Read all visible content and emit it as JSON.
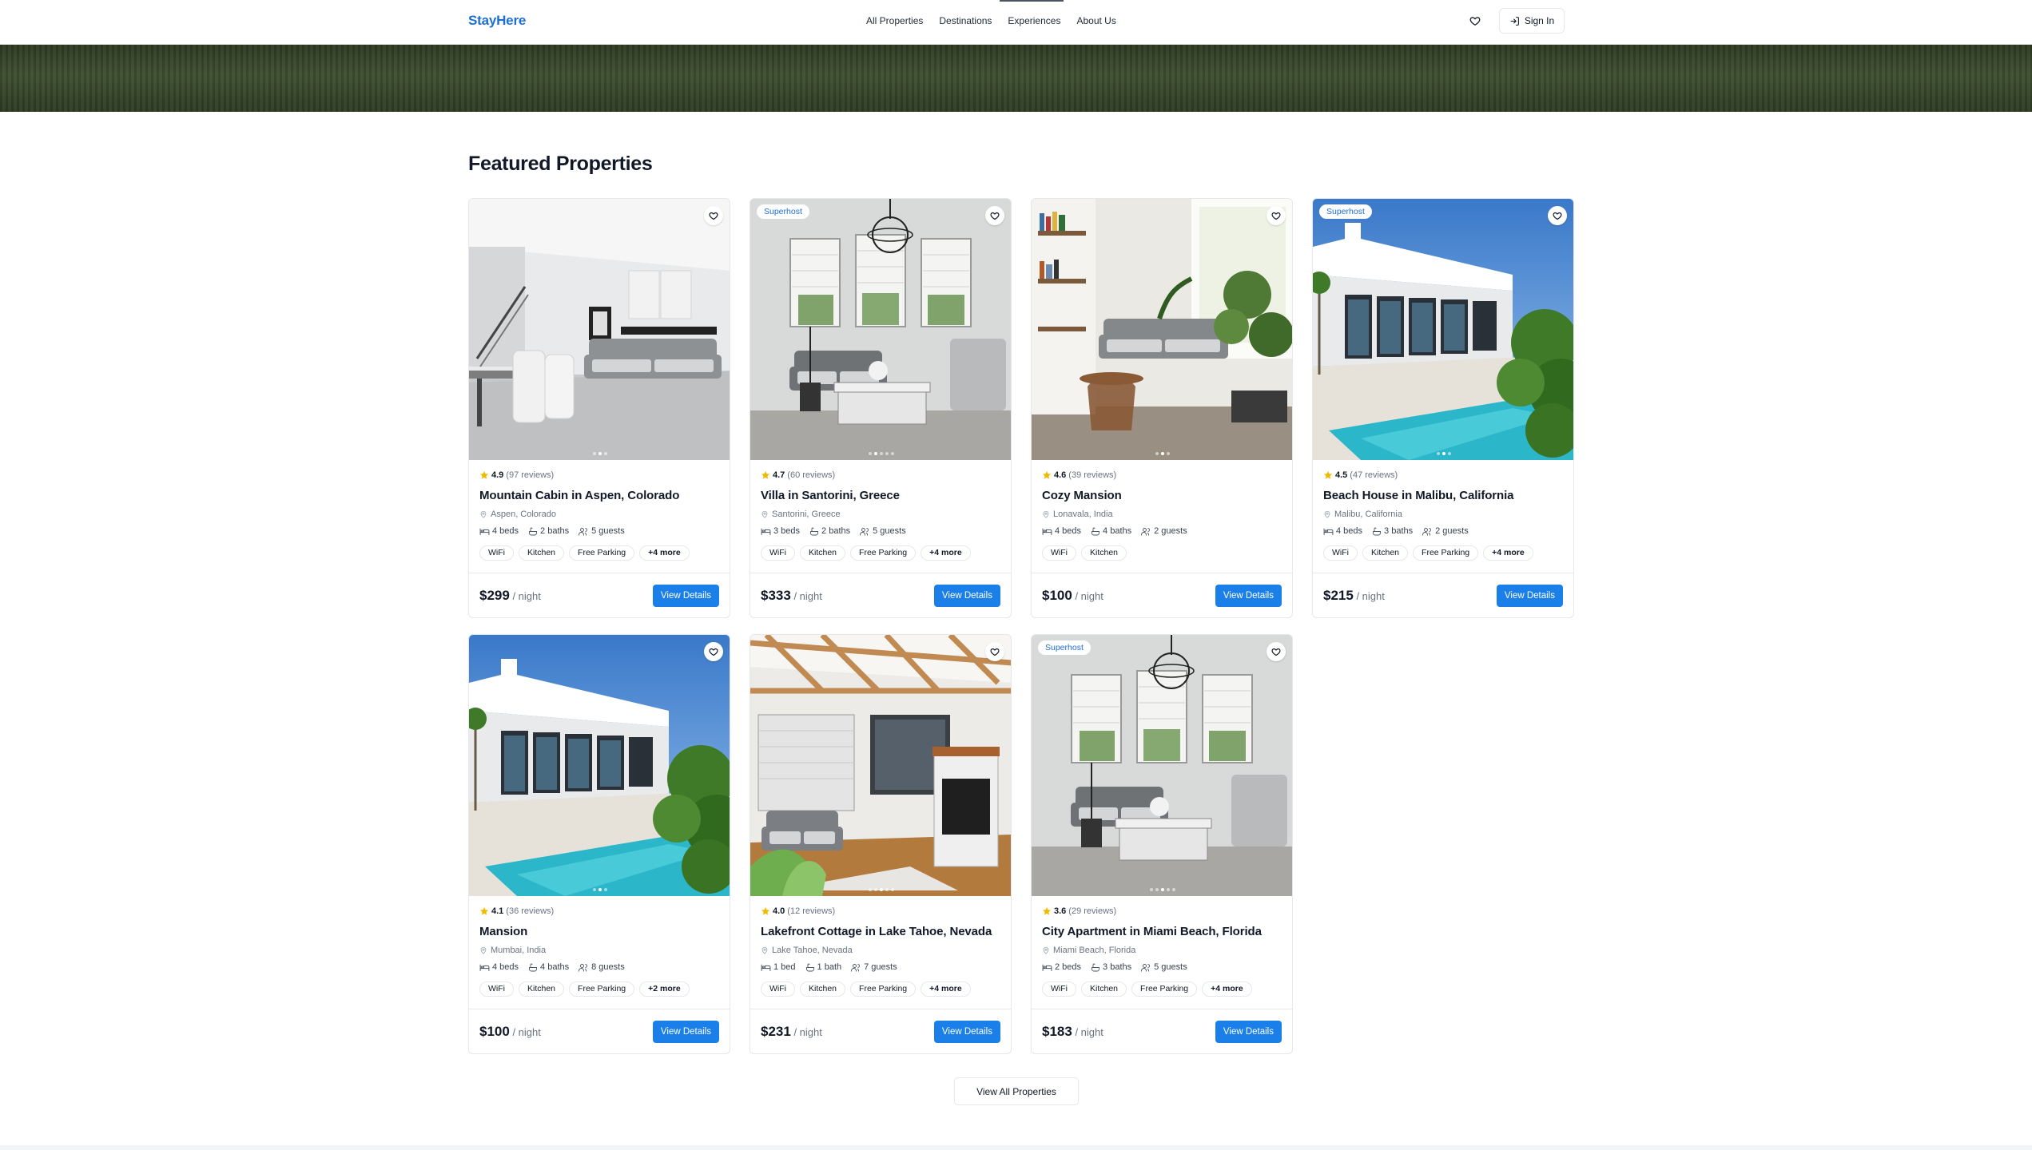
{
  "header": {
    "logo": "StayHere",
    "nav": [
      "All Properties",
      "Destinations",
      "Experiences",
      "About Us"
    ],
    "signin_label": "Sign In"
  },
  "section_title": "Featured Properties",
  "properties": [
    {
      "rating": "4.9",
      "reviews": "(97 reviews)",
      "title": "Mountain Cabin in Aspen, Colorado",
      "location": "Aspen, Colorado",
      "beds": "4 beds",
      "baths": "2 baths",
      "guests": "5 guests",
      "amenities": [
        "WiFi",
        "Kitchen",
        "Free Parking"
      ],
      "more": "+4 more",
      "price": "$299",
      "per": " / night",
      "cta": "View Details",
      "badge": ""
    },
    {
      "rating": "4.7",
      "reviews": "(60 reviews)",
      "title": "Villa in Santorini, Greece",
      "location": "Santorini, Greece",
      "beds": "3 beds",
      "baths": "2 baths",
      "guests": "5 guests",
      "amenities": [
        "WiFi",
        "Kitchen",
        "Free Parking"
      ],
      "more": "+4 more",
      "price": "$333",
      "per": " / night",
      "cta": "View Details",
      "badge": "Superhost"
    },
    {
      "rating": "4.6",
      "reviews": "(39 reviews)",
      "title": "Cozy Mansion",
      "location": "Lonavala, India",
      "beds": "4 beds",
      "baths": "4 baths",
      "guests": "2 guests",
      "amenities": [
        "WiFi",
        "Kitchen"
      ],
      "more": "",
      "price": "$100",
      "per": " / night",
      "cta": "View Details",
      "badge": ""
    },
    {
      "rating": "4.5",
      "reviews": "(47 reviews)",
      "title": "Beach House in Malibu, California",
      "location": "Malibu, California",
      "beds": "4 beds",
      "baths": "3 baths",
      "guests": "2 guests",
      "amenities": [
        "WiFi",
        "Kitchen",
        "Free Parking"
      ],
      "more": "+4 more",
      "price": "$215",
      "per": " / night",
      "cta": "View Details",
      "badge": "Superhost"
    },
    {
      "rating": "4.1",
      "reviews": "(36 reviews)",
      "title": "Mansion",
      "location": "Mumbai, India",
      "beds": "4 beds",
      "baths": "4 baths",
      "guests": "8 guests",
      "amenities": [
        "WiFi",
        "Kitchen",
        "Free Parking"
      ],
      "more": "+2 more",
      "price": "$100",
      "per": " / night",
      "cta": "View Details",
      "badge": ""
    },
    {
      "rating": "4.0",
      "reviews": "(12 reviews)",
      "title": "Lakefront Cottage in Lake Tahoe, Nevada",
      "location": "Lake Tahoe, Nevada",
      "beds": "1 bed",
      "baths": "1 bath",
      "guests": "7 guests",
      "amenities": [
        "WiFi",
        "Kitchen",
        "Free Parking"
      ],
      "more": "+4 more",
      "price": "$231",
      "per": " / night",
      "cta": "View Details",
      "badge": ""
    },
    {
      "rating": "3.6",
      "reviews": "(29 reviews)",
      "title": "City Apartment in Miami Beach, Florida",
      "location": "Miami Beach, Florida",
      "beds": "2 beds",
      "baths": "3 baths",
      "guests": "5 guests",
      "amenities": [
        "WiFi",
        "Kitchen",
        "Free Parking"
      ],
      "more": "+4 more",
      "price": "$183",
      "per": " / night",
      "cta": "View Details",
      "badge": "Superhost"
    }
  ],
  "view_all_label": "View All Properties",
  "colors": {
    "brand": "#1d6fd6",
    "button": "#1a7fe8",
    "star": "#f5b800"
  },
  "icons": [
    "heart-icon",
    "sign-in-icon",
    "star-icon",
    "map-pin-icon",
    "bed-icon",
    "bath-icon",
    "users-icon"
  ]
}
